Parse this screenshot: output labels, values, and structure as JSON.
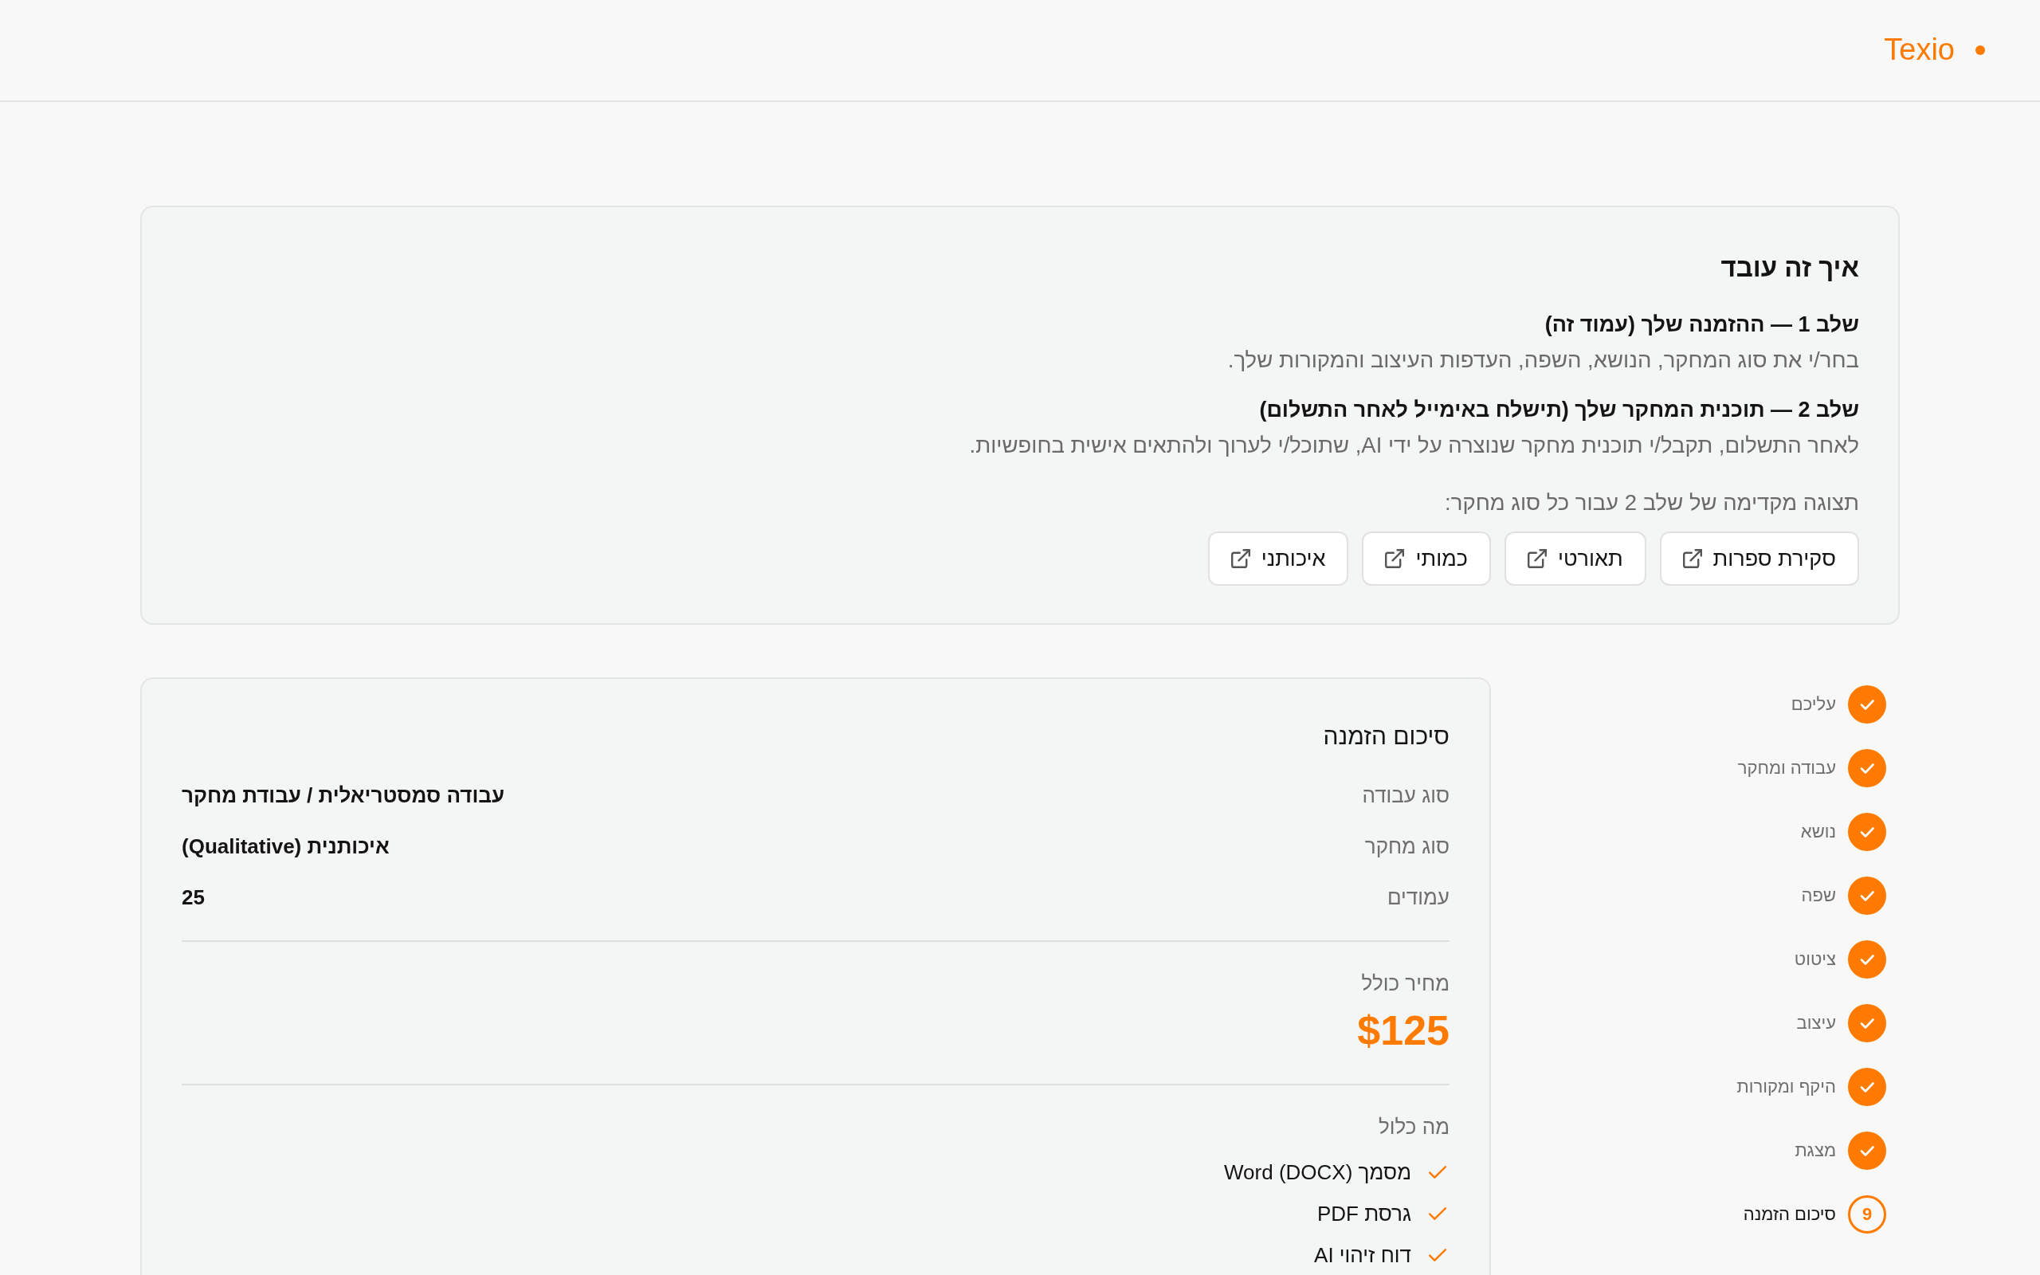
{
  "header": {
    "logo": "Texio"
  },
  "how_it_works": {
    "title": "איך זה עובד",
    "steps": [
      {
        "heading": "שלב 1 — ההזמנה שלך (עמוד זה)",
        "description": "בחר/י את סוג המחקר, הנושא, השפה, העדפות העיצוב והמקורות שלך."
      },
      {
        "heading": "שלב 2 — תוכנית המחקר שלך (תישלח באימייל לאחר התשלום)",
        "description": "לאחר התשלום, תקבל/י תוכנית מחקר שנוצרה על ידי AI, שתוכל/י לערוך ולהתאים אישית בחופשיות."
      }
    ],
    "preview_label": "תצוגה מקדימה של שלב 2 עבור כל סוג מחקר:",
    "preview_buttons": [
      "סקירת ספרות",
      "תאורטי",
      "כמותי",
      "איכותני"
    ]
  },
  "stepper": {
    "steps": [
      {
        "label": "עליכם",
        "completed": true,
        "selected": false
      },
      {
        "label": "עבודה ומחקר",
        "completed": true,
        "selected": false
      },
      {
        "label": "נושא",
        "completed": true,
        "selected": false
      },
      {
        "label": "שפה",
        "completed": true,
        "selected": false
      },
      {
        "label": "ציטוט",
        "completed": true,
        "selected": false
      },
      {
        "label": "עיצוב",
        "completed": true,
        "selected": false
      },
      {
        "label": "היקף ומקורות",
        "completed": true,
        "selected": false
      },
      {
        "label": "מצגת",
        "completed": true,
        "selected": false
      },
      {
        "label": "סיכום הזמנה",
        "number": "9",
        "completed": false,
        "selected": true
      }
    ]
  },
  "order_summary": {
    "title": "סיכום הזמנה",
    "rows": [
      {
        "label": "סוג עבודה",
        "value": "עבודה סמסטריאלית / עבודת מחקר"
      },
      {
        "label": "סוג מחקר",
        "value": "איכותנית (Qualitative)"
      },
      {
        "label": "עמודים",
        "value": "25"
      }
    ],
    "total_label": "מחיר כולל",
    "total": "$125",
    "included_label": "מה כלול",
    "included": [
      "מסמך Word (DOCX)",
      "גרסת PDF",
      "דוח זיהוי AI"
    ]
  }
}
